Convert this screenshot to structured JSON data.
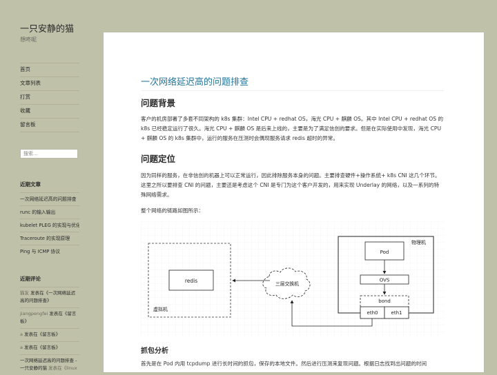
{
  "site": {
    "title": "一只安静的猫",
    "description": "想咚呢"
  },
  "menu": [
    "首页",
    "文章列表",
    "打赏",
    "收藏",
    "留言板"
  ],
  "search": {
    "placeholder": "搜索..."
  },
  "widgets": {
    "recent_posts_title": "近期文章",
    "recent_posts": [
      "一次网络延迟高的问题排查",
      "runc 的输入输出",
      "kubelet PLEG 的实现与优化",
      "Traceroute 的实现原理",
      "Ping 与 ICMP 协议"
    ],
    "recent_comments_title": "近期评论",
    "recent_comments": [
      {
        "author": "猫友",
        "text": "发表在《一次网络延迟高的问题排查》"
      },
      {
        "author": "jiangpengfei",
        "text": "发表在《留言板》"
      },
      {
        "author": "a",
        "text": "发表在《留言板》"
      },
      {
        "author": "a",
        "text": "发表在《留言板》"
      },
      {
        "author": "一次网络延迟高的问题排查 - 一只安静的猫",
        "text": "发表在《linux"
      }
    ]
  },
  "article": {
    "title": "一次网络延迟高的问题排查",
    "h_background": "问题背景",
    "p_background": "客户的机房部署了多套不同架构的 k8s 集群：Intel CPU + redhat OS，海光 CPU + 麒麟 OS。其中 Intel CPU + redhat OS 的 k8s 已经稳定运行了很久。海光 CPU + 麒麟 OS 是后来上线的，主要是为了满足信创的要求。但是在实际使用中发现，海光 CPU + 麒麟 OS 的 k8s 集群中，运行的服务在压测时会偶现服务请求 redis 超时的异常。",
    "h_locate": "问题定位",
    "p_locate": "因为同样的服务，在非信创的机器上可以正常运行，因此排除服务本身的问题。主要排查硬件+操作系统+ k8s CNI 这几个环节。这里之所以要排查 CNI 的问题，主要还是考虑这个 CNI 是专门为这个客户开发的，用来实现 Underlay 的网络，以及一系列的特殊网络需求。",
    "p_chain": "整个网络的链路如图所示：",
    "h_capture": "抓包分析",
    "p_capture": "首先是在 Pod 内用 tcpdump 进行长时间的抓包，保存的本地文件。然后进行压测来复现问题。根据日志找到出问题的时间"
  },
  "diagram": {
    "vm_label": "虚拟机",
    "redis_label": "redis",
    "switch_label": "三层交换机",
    "host_label": "物理机",
    "pod_label": "Pod",
    "ovs_label": "OVS",
    "bond_label": "bond",
    "eth0_label": "eth0",
    "eth1_label": "eth1"
  }
}
